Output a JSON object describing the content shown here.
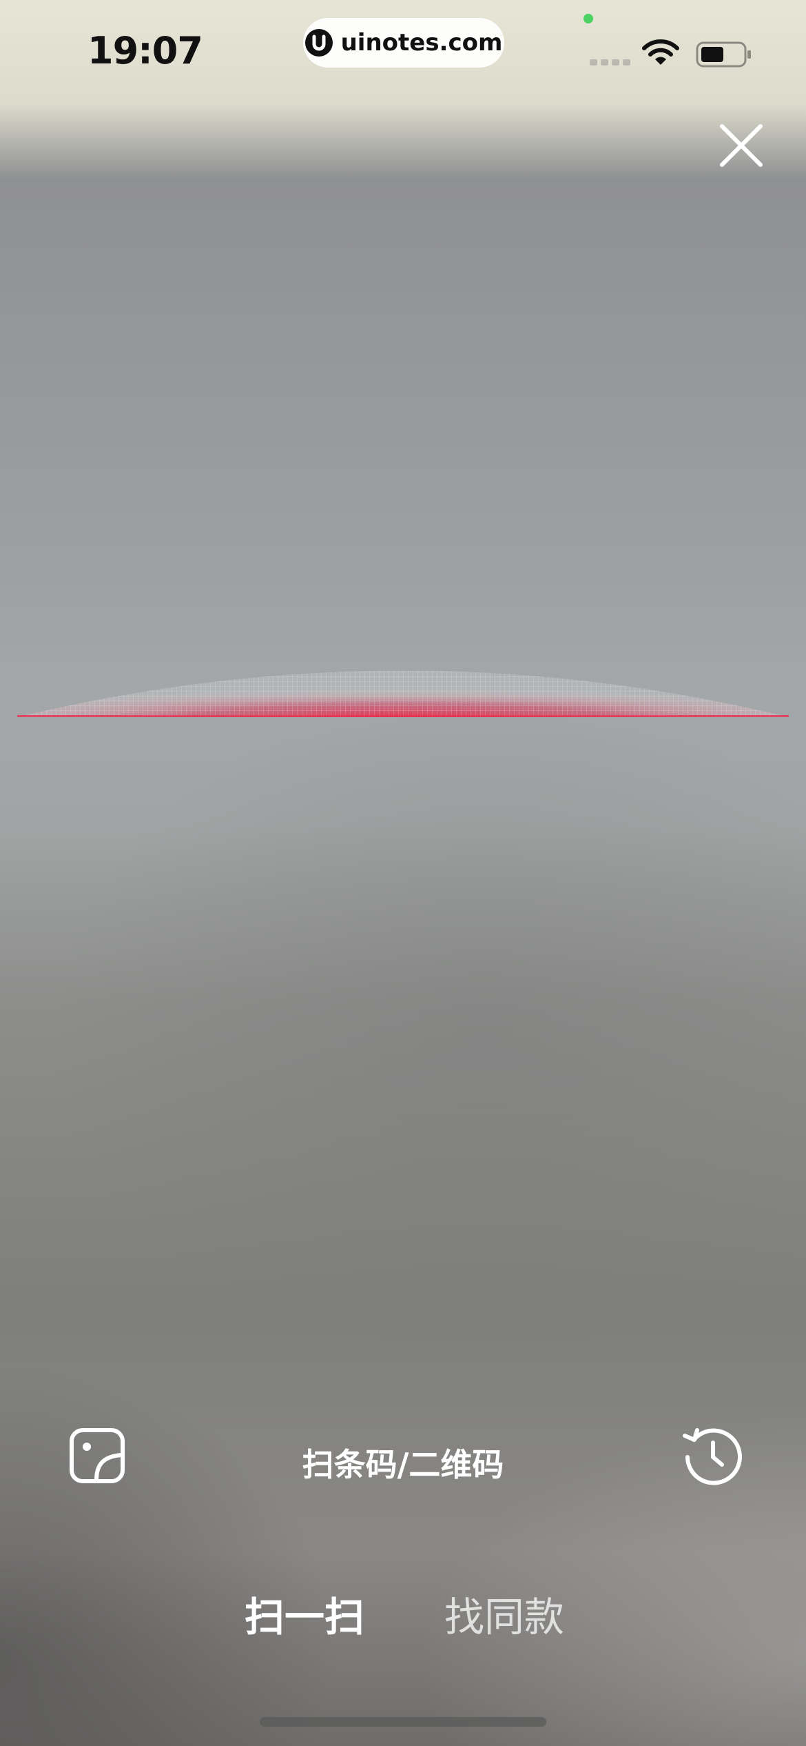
{
  "status_bar": {
    "time": "19:07",
    "url": "uinotes.com",
    "icons": [
      "signal-icon",
      "wifi-icon",
      "battery-icon"
    ]
  },
  "header": {
    "close_icon": "close-icon"
  },
  "scanner": {
    "line_color": "#e8304f"
  },
  "bottom_controls": {
    "album_icon": "album-icon",
    "scan_label": "扫条码/二维码",
    "history_icon": "history-icon"
  },
  "tabs": [
    {
      "label": "扫一扫",
      "active": true
    },
    {
      "label": "找同款",
      "active": false
    }
  ]
}
